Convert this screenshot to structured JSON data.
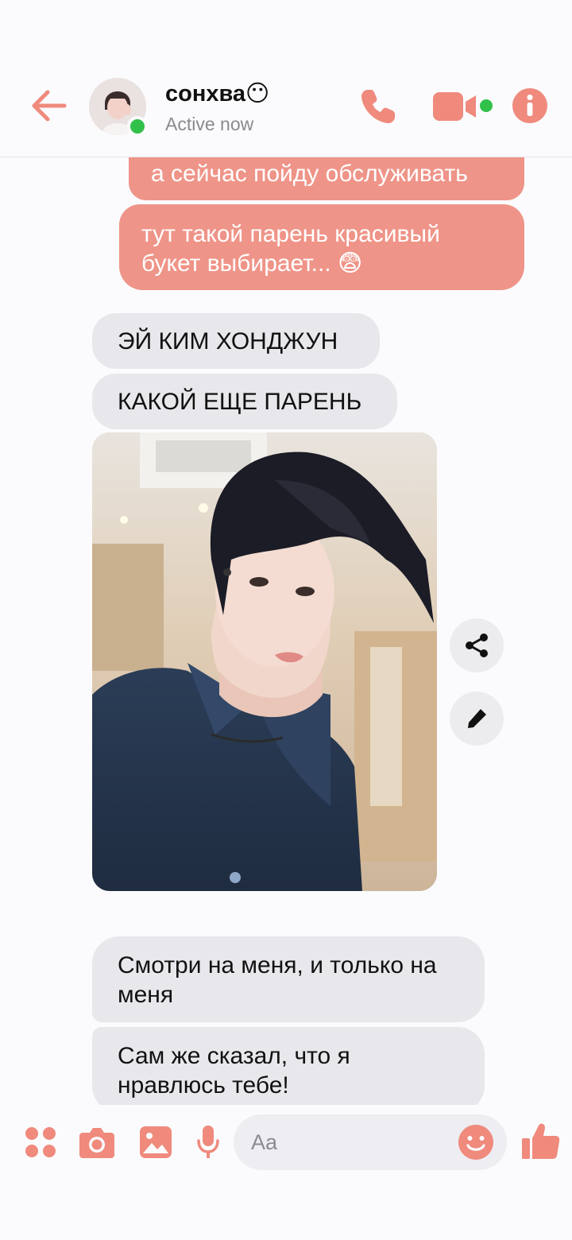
{
  "header": {
    "contact_name": "сонхва😶",
    "status": "Active now"
  },
  "messages": [
    {
      "id": "m1",
      "direction": "outgoing",
      "text": "а сейчас пойду обслуживать"
    },
    {
      "id": "m2",
      "direction": "outgoing",
      "text": "тут такой парень красивый букет выбирает... 😨"
    },
    {
      "id": "m3",
      "direction": "incoming",
      "text": "ЭЙ КИМ ХОНДЖУН"
    },
    {
      "id": "m4",
      "direction": "incoming",
      "text": "КАКОЙ ЕЩЕ ПАРЕНЬ"
    },
    {
      "id": "m5",
      "direction": "incoming",
      "text": "Смотри на меня, и только на меня"
    },
    {
      "id": "m6",
      "direction": "incoming",
      "text": "Сам же сказал, что я нравлюсь тебе!"
    }
  ],
  "composer": {
    "placeholder": "Aa"
  },
  "icons": {
    "back": "arrow-left-icon",
    "call": "phone-icon",
    "video": "video-camera-icon",
    "info": "info-icon",
    "share": "share-icon",
    "edit": "pencil-icon",
    "apps": "apps-icon",
    "camera": "camera-icon",
    "gallery": "image-icon",
    "mic": "microphone-icon",
    "emoji": "smiley-icon",
    "like": "thumbs-up-icon"
  },
  "colors": {
    "accent": "#ef8a7d",
    "outgoing_bubble": "#ef9488",
    "incoming_bubble": "#e8e7ec",
    "online": "#31c14a"
  }
}
